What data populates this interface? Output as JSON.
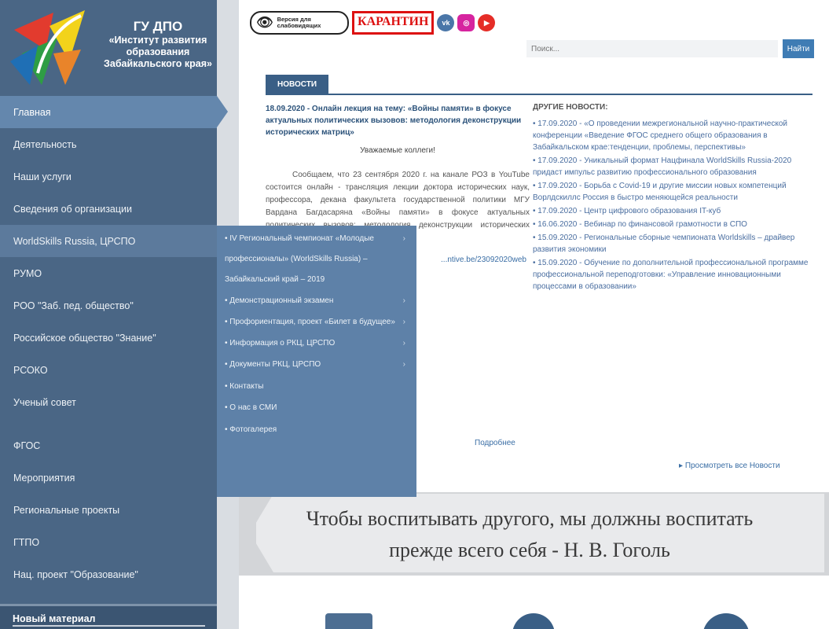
{
  "org": {
    "line1": "ГУ ДПО",
    "line2": "«Институт развития образования Забайкальского края»"
  },
  "menu": [
    {
      "label": "Главная"
    },
    {
      "label": "Деятельность"
    },
    {
      "label": "Наши услуги"
    },
    {
      "label": "Сведения об организации"
    },
    {
      "label": "WorldSkills Russia, ЦРСПО"
    },
    {
      "label": "РУМО"
    },
    {
      "label": "РОО \"Заб. пед. общество\""
    },
    {
      "label": "Российское общество \"Знание\""
    },
    {
      "label": "РСОКО"
    },
    {
      "label": "Ученый совет"
    },
    {
      "label": "ФГОС"
    },
    {
      "label": "Мероприятия"
    },
    {
      "label": "Региональные проекты"
    },
    {
      "label": "ГТПО"
    },
    {
      "label": "Нац. проект \"Образование\""
    }
  ],
  "new_material": "Новый материал",
  "topbar": {
    "vision_label": "Версия для слабовидящих",
    "quarantine": "КАРАНТИН"
  },
  "search": {
    "placeholder": "Поиск...",
    "button": "Найти"
  },
  "news_tab": "НОВОСТИ",
  "left_news": {
    "headline": "18.09.2020 - Онлайн лекция на тему: «Войны памяти» в фокусе актуальных политических вызовов: методология деконструкции исторических матриц»",
    "salute": "Уважаемые коллеги!",
    "body": "Сообщаем, что 23 сентября 2020 г. на канале РОЗ в YouTube состоится онлайн - трансляция лекции доктора исторических наук, профессора, декана факультета государственной политики МГУ Вардана Багдасаряна «Войны памяти» в фокусе актуальных политических вызовов: методология деконструкции исторических матриц».",
    "link": "...ntive.be/23092020web",
    "more": "Подробнее"
  },
  "other_news": {
    "title": "ДРУГИЕ НОВОСТИ:",
    "items": [
      "17.09.2020 - «О проведении межрегиональной научно-практической конференции «Введение ФГОС среднего общего образования в Забайкальском крае:тенденции, проблемы, перспективы»",
      "17.09.2020 - Уникальный формат Нацфинала WorldSkills Russia-2020 придаст импульс развитию профессионального образования",
      "17.09.2020 - Борьба с Covid-19 и другие миссии новых компетенций Ворлдскиллс Россия в быстро меняющейся реальности",
      "17.09.2020 - Центр цифрового образования IT-куб",
      "16.06.2020 - Вебинар по финансовой грамотности в СПО",
      "15.09.2020 - Региональные сборные чемпионата Worldskills – драйвер развития экономики",
      "15.09.2020 - Обучение по дополнительной профессиональной программе профессиональной переподготовки: «Управление инновационными процессами в образовании»"
    ],
    "all": "Просмотреть все Новости"
  },
  "submenu": [
    {
      "label": "IV Региональный чемпионат «Молодые профессионалы» (WorldSkills Russia) – Забайкальский край – 2019",
      "arrow": "›"
    },
    {
      "label": "Демонстрационный экзамен",
      "arrow": "›"
    },
    {
      "label": "Профориентация, проект «Билет в будущее»",
      "arrow": "›"
    },
    {
      "label": "Информация о РКЦ, ЦРСПО",
      "arrow": "›"
    },
    {
      "label": "Документы РКЦ, ЦРСПО",
      "arrow": "›"
    },
    {
      "label": "Контакты",
      "arrow": ""
    },
    {
      "label": "О нас в СМИ",
      "arrow": ""
    },
    {
      "label": "Фотогалерея",
      "arrow": ""
    }
  ],
  "quote": {
    "text": "Чтобы воспитывать другого, мы должны воспитать прежде всего себя - Н. В. Гоголь"
  },
  "colors": {
    "sidebar": "#4a6685",
    "active": "#6487ad",
    "submenu": "#5e81a8",
    "accent": "#3a5f86"
  }
}
